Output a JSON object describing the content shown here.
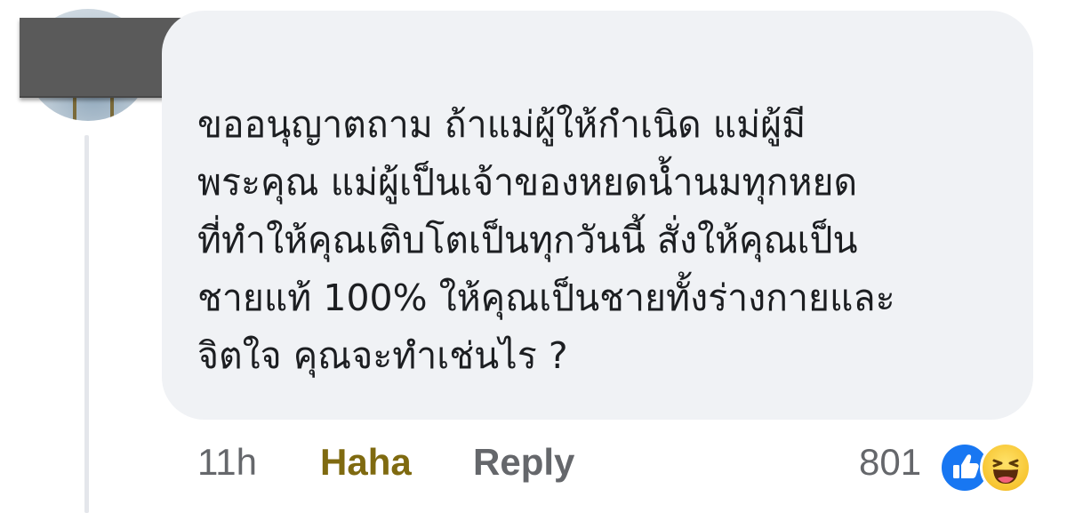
{
  "comment": {
    "author_redacted": true,
    "text_lines": [
      "ขออนุญาตถาม ถ้าแม่ผู้ให้กำเนิด แม่ผู้มี",
      "พระคุณ แม่ผู้เป็นเจ้าของหยดน้ำนมทุกหยด",
      "ที่ทำให้คุณเติบโตเป็นทุกวันนี้ สั่งให้คุณเป็น",
      "ชายแท้ 100% ให้คุณเป็นชายทั้งร่างกายและ",
      "จิตใจ คุณจะทำเช่นไร ?"
    ],
    "timestamp": "11h",
    "reaction_label": "Haha",
    "reply_label": "Reply",
    "reaction_count": "801",
    "reaction_icons": [
      "like-icon",
      "haha-icon"
    ],
    "colors": {
      "bubble": "#f0f2f5",
      "haha_label": "#7f6a10",
      "like_blue": "#1877f2",
      "haha_yellow": "#f7c531",
      "muted_text": "#65676b"
    }
  }
}
